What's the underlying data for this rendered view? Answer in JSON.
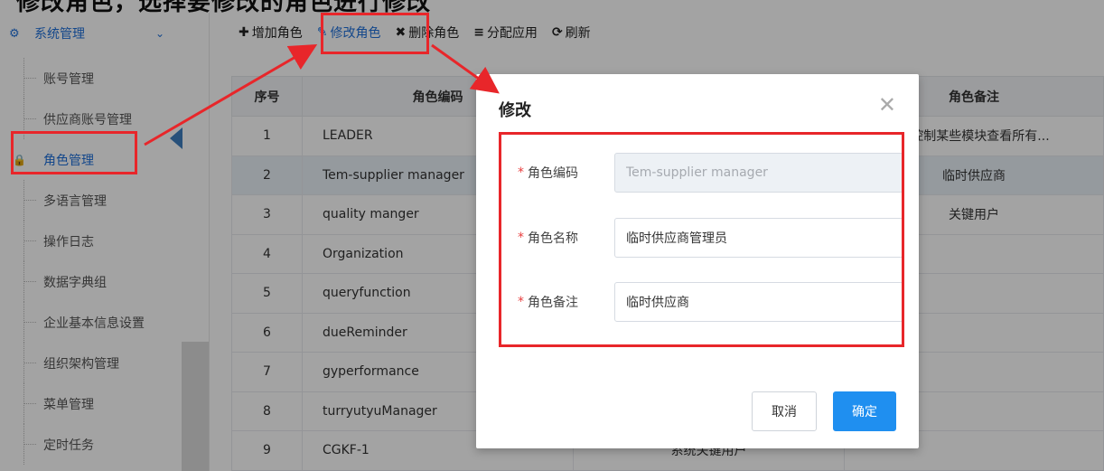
{
  "caption": "修改角色，选择要修改的角色进行修改",
  "sidebar": {
    "header": "系统管理",
    "icons": {
      "header": "gears-icon",
      "collapse": "chevron-down-icon",
      "active": "lock-icon"
    },
    "items": [
      {
        "label": "账号管理"
      },
      {
        "label": "供应商账号管理"
      },
      {
        "label": "角色管理"
      },
      {
        "label": "多语言管理"
      },
      {
        "label": "操作日志"
      },
      {
        "label": "数据字典组"
      },
      {
        "label": "企业基本信息设置"
      },
      {
        "label": "组织架构管理"
      },
      {
        "label": "菜单管理"
      },
      {
        "label": "定时任务"
      }
    ]
  },
  "toolbar": {
    "add": "增加角色",
    "edit": "修改角色",
    "delete": "删除角色",
    "assign": "分配应用",
    "refresh": "刷新"
  },
  "table": {
    "headers": {
      "no": "序号",
      "code": "角色编码",
      "name": "",
      "note": "角色备注"
    },
    "rows": [
      {
        "no": "1",
        "code": "LEADER",
        "name": "",
        "note": "于控制某些模块查看所有..."
      },
      {
        "no": "2",
        "code": "Tem-supplier manager",
        "name": "",
        "note": "临时供应商"
      },
      {
        "no": "3",
        "code": "quality manger",
        "name": "",
        "note": "关键用户"
      },
      {
        "no": "4",
        "code": "Organization",
        "name": "",
        "note": ""
      },
      {
        "no": "5",
        "code": "queryfunction",
        "name": "",
        "note": ""
      },
      {
        "no": "6",
        "code": "dueReminder",
        "name": "",
        "note": ""
      },
      {
        "no": "7",
        "code": "gyperformance",
        "name": "",
        "note": ""
      },
      {
        "no": "8",
        "code": "turryutyuManager",
        "name": "",
        "note": ""
      },
      {
        "no": "9",
        "code": "CGKF-1",
        "name": "系统关键用户",
        "note": ""
      }
    ]
  },
  "modal": {
    "title": "修改",
    "required_mark": "*",
    "fields": {
      "code": {
        "label": "角色编码",
        "value": "Tem-supplier manager"
      },
      "name": {
        "label": "角色名称",
        "value": "临时供应商管理员"
      },
      "note": {
        "label": "角色备注",
        "value": "临时供应商"
      }
    },
    "cancel": "取消",
    "confirm": "确定"
  },
  "colors": {
    "accent": "#1e6fd9",
    "annotation": "#e8262a",
    "confirm": "#1f8ff0"
  }
}
